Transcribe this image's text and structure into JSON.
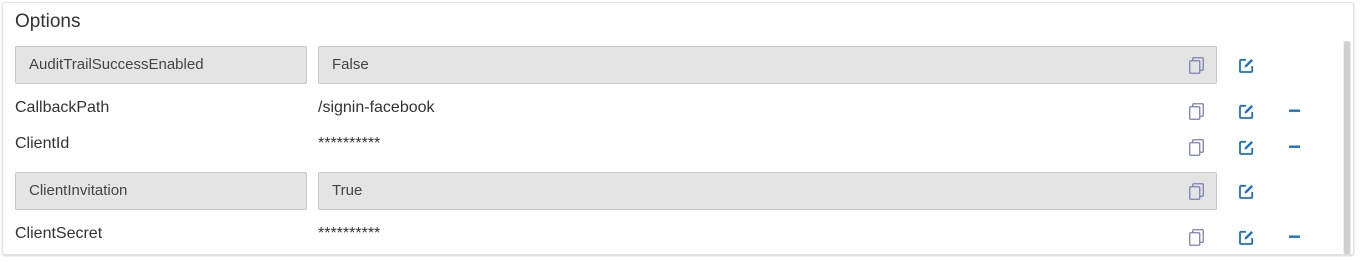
{
  "panel": {
    "title": "Options"
  },
  "rows": [
    {
      "key": "AuditTrailSuccessEnabled",
      "value": "False",
      "editing": true,
      "removable": false
    },
    {
      "key": "CallbackPath",
      "value": "/signin-facebook",
      "editing": false,
      "removable": true
    },
    {
      "key": "ClientId",
      "value": "**********",
      "editing": false,
      "removable": true
    },
    {
      "key": "ClientInvitation",
      "value": "True",
      "editing": true,
      "removable": false
    },
    {
      "key": "ClientSecret",
      "value": "**********",
      "editing": false,
      "removable": true
    }
  ],
  "icons": {
    "copy": "copy-icon",
    "edit": "edit-icon",
    "remove": "minus-icon"
  },
  "colors": {
    "accent": "#1a73c8",
    "copy_icon": "#7a7fb0",
    "field_bg": "#e4e4e4"
  }
}
